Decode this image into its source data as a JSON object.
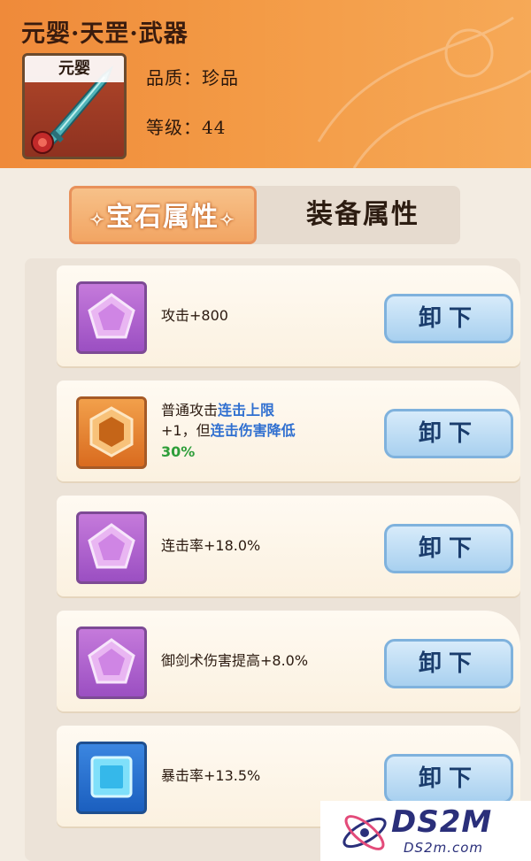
{
  "header": {
    "title": "元婴·天罡·武器",
    "item_badge": "元婴",
    "quality_label": "品质：",
    "quality_value": "珍品",
    "level_label": "等级：",
    "level_value": "44",
    "weapon_icon": "sword-icon"
  },
  "tabs": [
    {
      "label": "宝石属性",
      "active": true
    },
    {
      "label": "装备属性",
      "active": false
    }
  ],
  "tab_decoration": "✧",
  "gems": [
    {
      "icon": "purple-gem-icon",
      "color": "purple",
      "text": "攻击+800",
      "button": "卸下"
    },
    {
      "icon": "orange-gem-icon",
      "color": "orange",
      "text_parts": [
        "普通攻击",
        "连击上限",
        "+1，但",
        "连击伤害降低",
        "30%"
      ],
      "button": "卸下"
    },
    {
      "icon": "purple-gem-icon",
      "color": "purple",
      "text": "连击率+18.0%",
      "button": "卸下"
    },
    {
      "icon": "purple-gem-icon",
      "color": "purple",
      "text": "御剑术伤害提高+8.0%",
      "button": "卸下"
    },
    {
      "icon": "blue-gem-icon",
      "color": "blue",
      "text": "暴击率+13.5%",
      "button": "卸下"
    }
  ],
  "watermark": {
    "main": "DS2M",
    "sub": "DS2m.com"
  },
  "colors": {
    "header_orange": "#f39a45",
    "tab_active": "#f2a563",
    "button_blue": "#a8d0ef",
    "highlight_blue": "#2f6fd0",
    "highlight_green": "#2e9e3a"
  }
}
